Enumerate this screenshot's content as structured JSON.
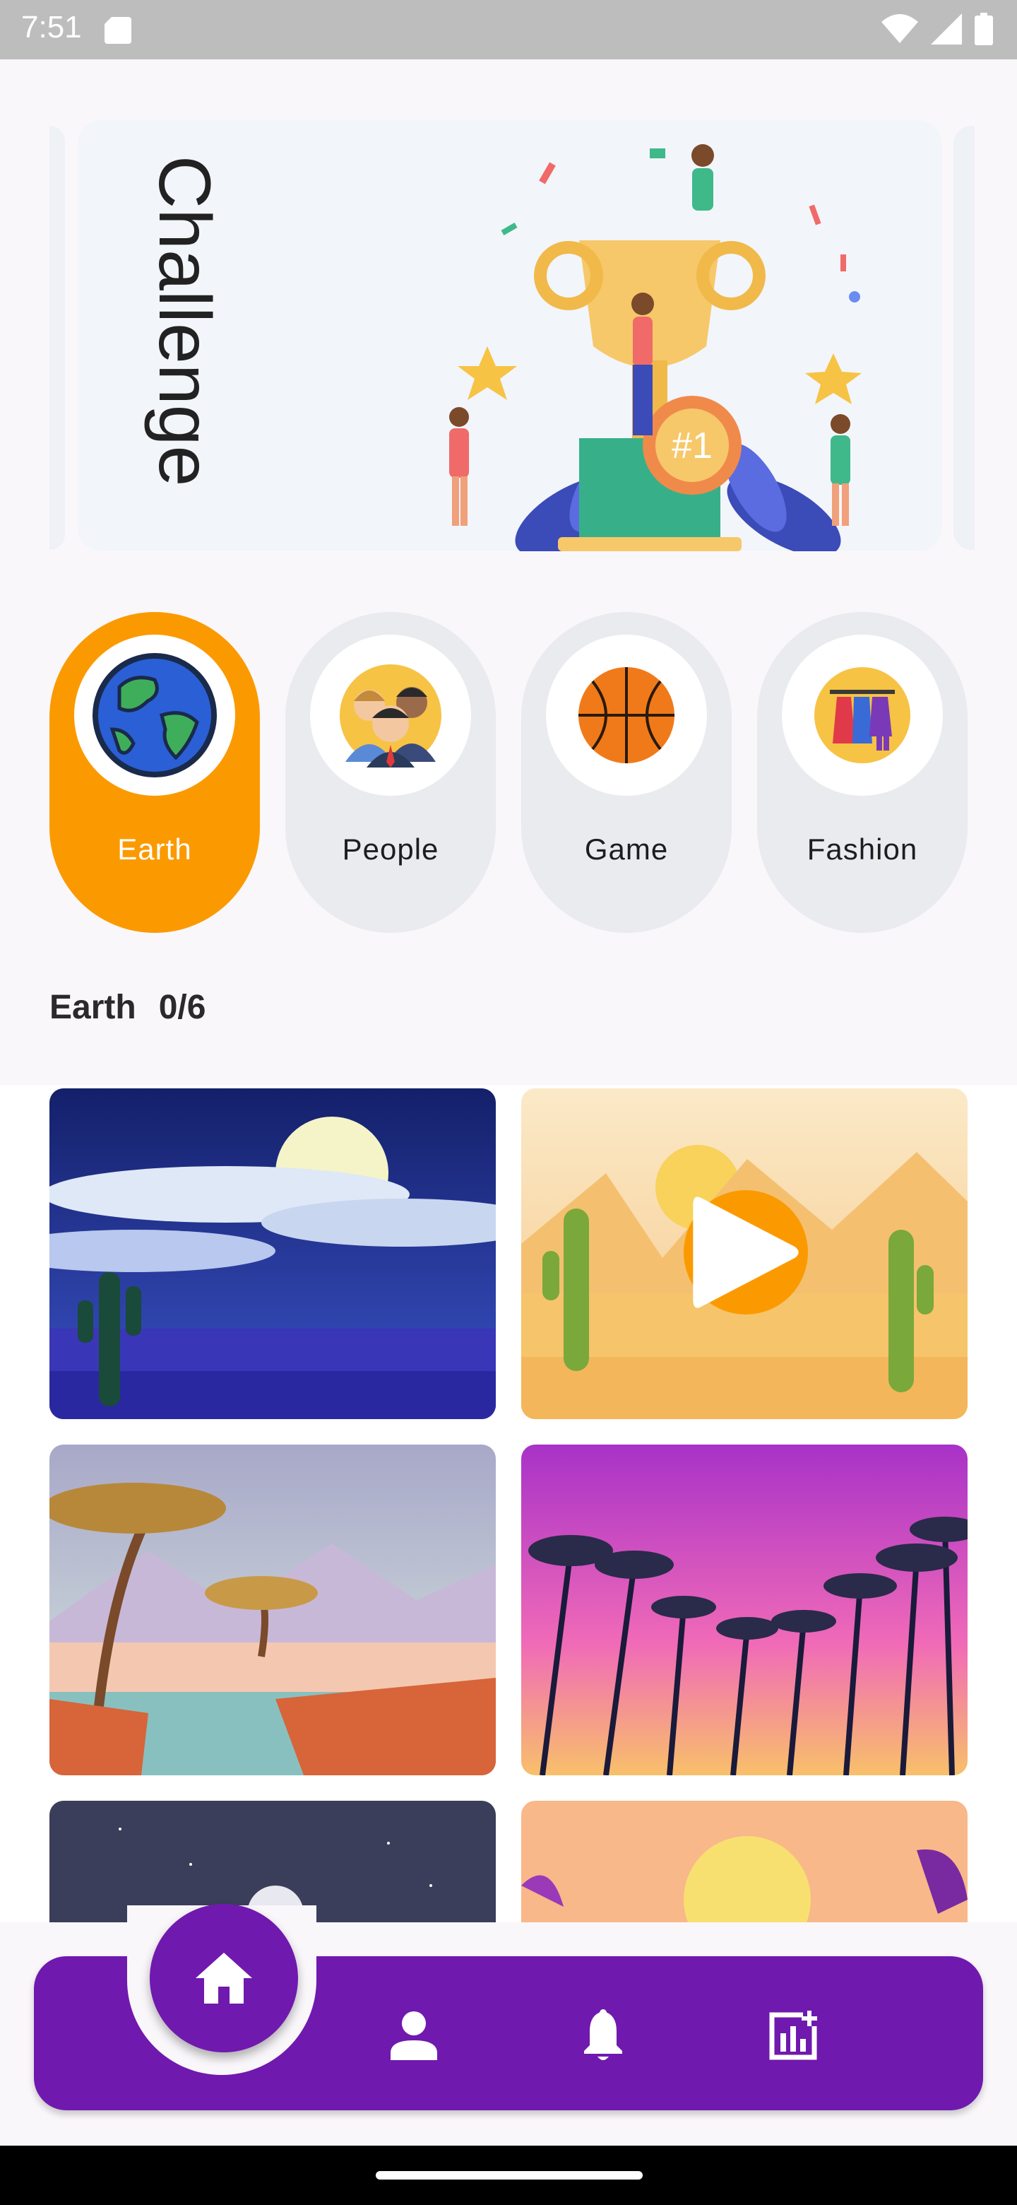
{
  "status_bar": {
    "time": "7:51",
    "icons": [
      "sd-card-icon",
      "wifi-icon",
      "signal-icon",
      "battery-icon"
    ]
  },
  "banner": {
    "title": "Challenge",
    "badge_text": "#1"
  },
  "categories": [
    {
      "label": "Earth",
      "icon": "earth-icon",
      "selected": true
    },
    {
      "label": "People",
      "icon": "people-icon",
      "selected": false
    },
    {
      "label": "Game",
      "icon": "basketball-icon",
      "selected": false
    },
    {
      "label": "Fashion",
      "icon": "clothes-rack-icon",
      "selected": false
    }
  ],
  "section": {
    "category": "Earth",
    "progress": "0/6"
  },
  "tiles": [
    {
      "name": "night-desert",
      "playing": false
    },
    {
      "name": "day-desert-cactus",
      "playing": true
    },
    {
      "name": "savanna-lake",
      "playing": false
    },
    {
      "name": "purple-palm-sunset",
      "playing": false
    },
    {
      "name": "starry-night-moon",
      "playing": false
    },
    {
      "name": "orange-sunset-birds",
      "playing": false
    }
  ],
  "bottom_nav": {
    "items": [
      "home-icon",
      "person-icon",
      "bell-icon",
      "chart-add-icon"
    ],
    "active": "home-icon"
  },
  "colors": {
    "accent": "#fb9a00",
    "nav": "#7019ae",
    "chip_inactive": "#e9ebee"
  }
}
